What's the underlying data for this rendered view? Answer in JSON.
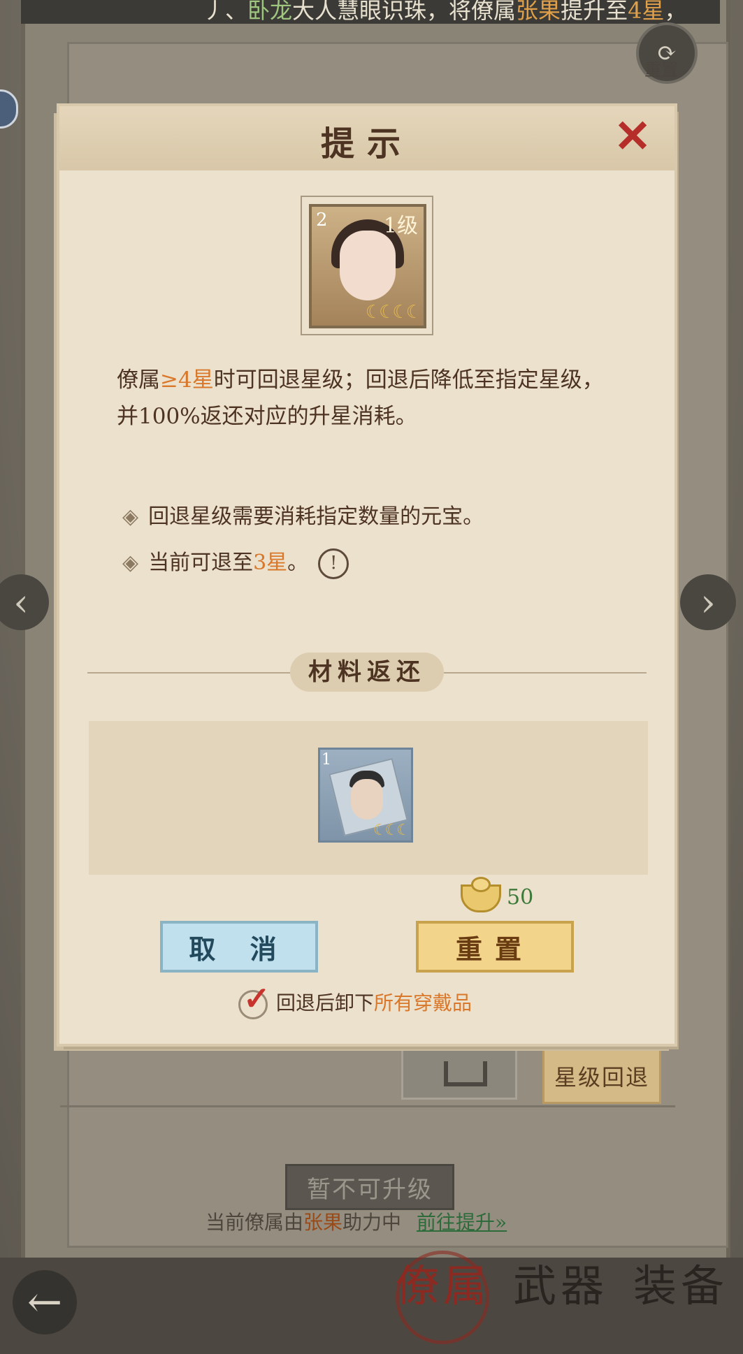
{
  "top_banner": {
    "pre": "丿、",
    "name": "卧龙",
    "mid": "大人慧眼识珠，将僚属",
    "target": "张果",
    "mid2": "提升至",
    "stars": "4星",
    "end": "，"
  },
  "reset_shortcut": {
    "label": "重置",
    "icon": "refresh-icon"
  },
  "nav": {
    "prev_icon": "chevron-left-icon",
    "next_icon": "chevron-right-icon"
  },
  "dialog": {
    "title": "提示",
    "close_icon": "close-icon",
    "portrait": {
      "level": "1级",
      "rank_badge": "2",
      "stars": "4"
    },
    "description": {
      "part1": "僚属",
      "highlight": "≥4星",
      "part2": "时可回退星级；回退后降低至指定星级，并100%返还对应的升星消耗。"
    },
    "bullets": [
      {
        "text": "回退星级需要消耗指定数量的元宝。"
      },
      {
        "text_pre": "当前可退至",
        "highlight": "3星",
        "text_post": "。"
      }
    ],
    "section_title": "材料返还",
    "material": {
      "rank_badge": "1",
      "stars": "3"
    },
    "cost": "50",
    "cancel_label": "取 消",
    "reset_label": "重置",
    "checkbox": {
      "checked": true,
      "pre": "回退后卸下",
      "highlight": "所有穿戴品"
    }
  },
  "background": {
    "star_back_button": "星级回退",
    "cannot_upgrade": "暂不可升级",
    "assist": {
      "pre": "当前僚属由",
      "name": "张果",
      "post": "助力中",
      "link": "前往提升»"
    }
  },
  "bottom_tabs": [
    {
      "label": "僚属",
      "active": true
    },
    {
      "label": "武器",
      "active": false
    },
    {
      "label": "装备",
      "active": false
    }
  ],
  "colors": {
    "accent_orange": "#d9772a",
    "close_red": "#b52e2a",
    "cost_green": "#3d7a3a"
  }
}
